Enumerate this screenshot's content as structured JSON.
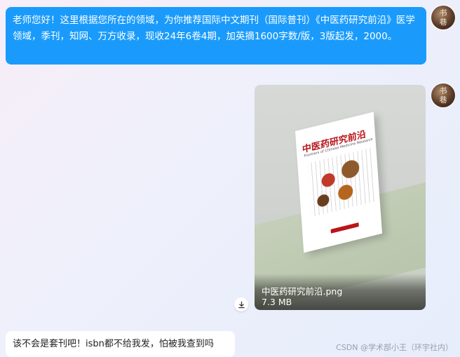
{
  "messages": {
    "incoming_1": {
      "text": "老师您好！这里根据您所在的领域，为你推荐国际中文期刊（国际普刊）《中医药研究前沿》医学领域，季刊，知网、万方收录，现收24年6卷4期，加英摘1600字数/版，3版起发，2000。",
      "avatar_glyph": "书\n巷"
    },
    "file_message": {
      "file_name": "中医药研究前沿.png",
      "file_size": "7.3 MB",
      "cover_title": "中医药研究前沿",
      "cover_subtitle": "Frontiers of Chinese Medicine Research",
      "avatar_glyph": "书\n巷"
    },
    "incoming_2": {
      "text": "该不会是套刊吧！isbn都不给我发，怕被我查到吗"
    }
  },
  "icons": {
    "download": "download-icon",
    "avatar": "avatar-image"
  },
  "watermark": "CSDN @学术部小王（环宇社内）",
  "colors": {
    "blue_bubble": "#1a9bfc",
    "white_bubble": "#ffffff"
  }
}
